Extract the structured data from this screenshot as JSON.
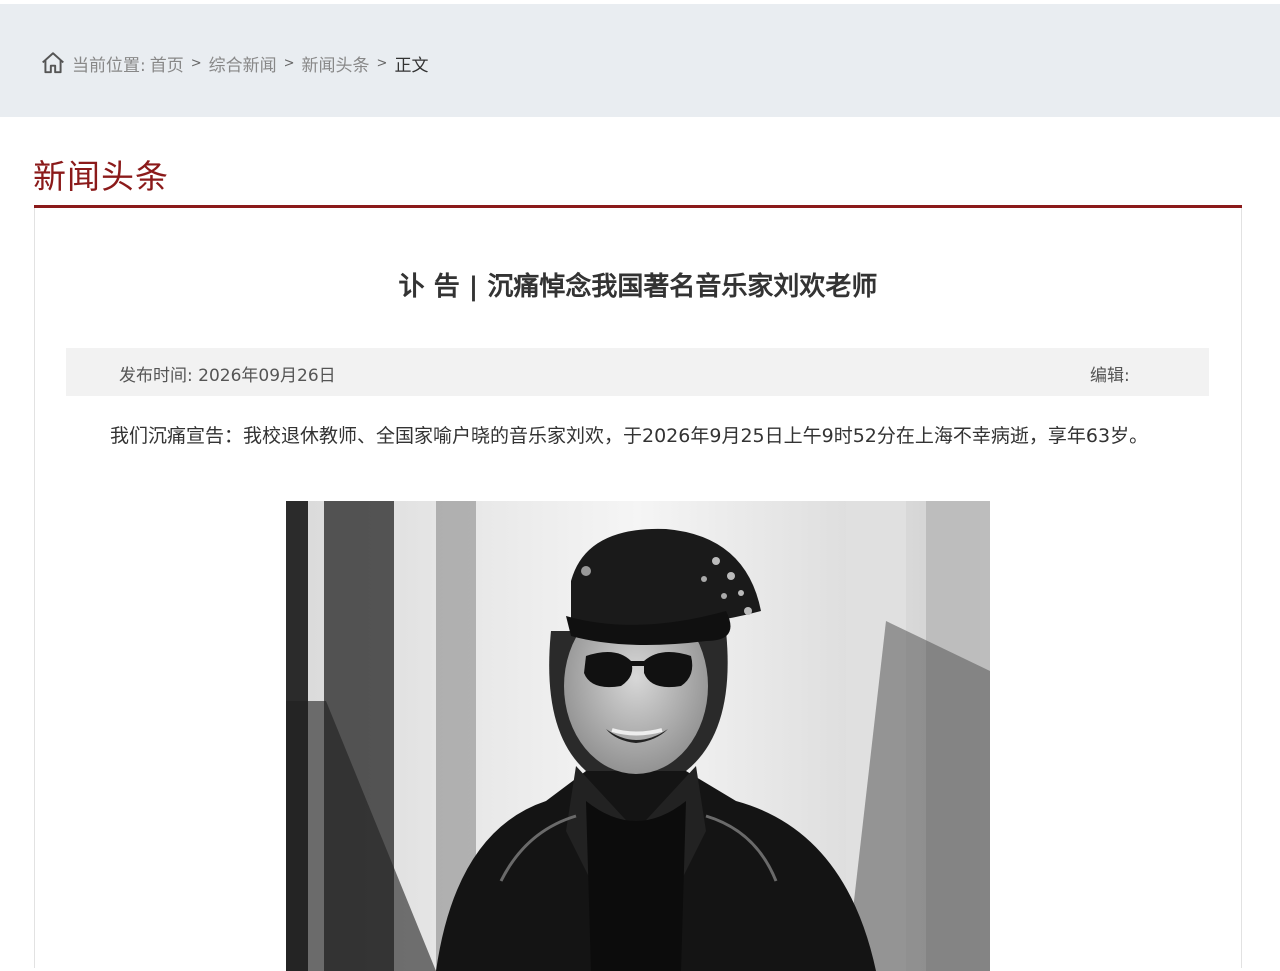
{
  "breadcrumb": {
    "prefix": "当前位置:",
    "items": [
      "首页",
      "综合新闻",
      "新闻头条"
    ],
    "current": "正文",
    "separator": ">"
  },
  "section": {
    "title": "新闻头条"
  },
  "article": {
    "title": "讣 告 | 沉痛悼念我国著名音乐家刘欢老师",
    "publish_label": "发布时间:",
    "publish_date": "2026年09月26日",
    "editor_label": "编辑:",
    "paragraph": "我们沉痛宣告：我校退休教师、全国家喻户晓的音乐家刘欢，于2026年9月25日上午9时52分在上海不幸病逝，享年63岁。"
  },
  "colors": {
    "accent": "#8b1a1a",
    "breadcrumb_bg": "#e9edf1",
    "meta_bg": "#f2f2f2"
  },
  "icons": {
    "breadcrumb": "home-icon"
  }
}
